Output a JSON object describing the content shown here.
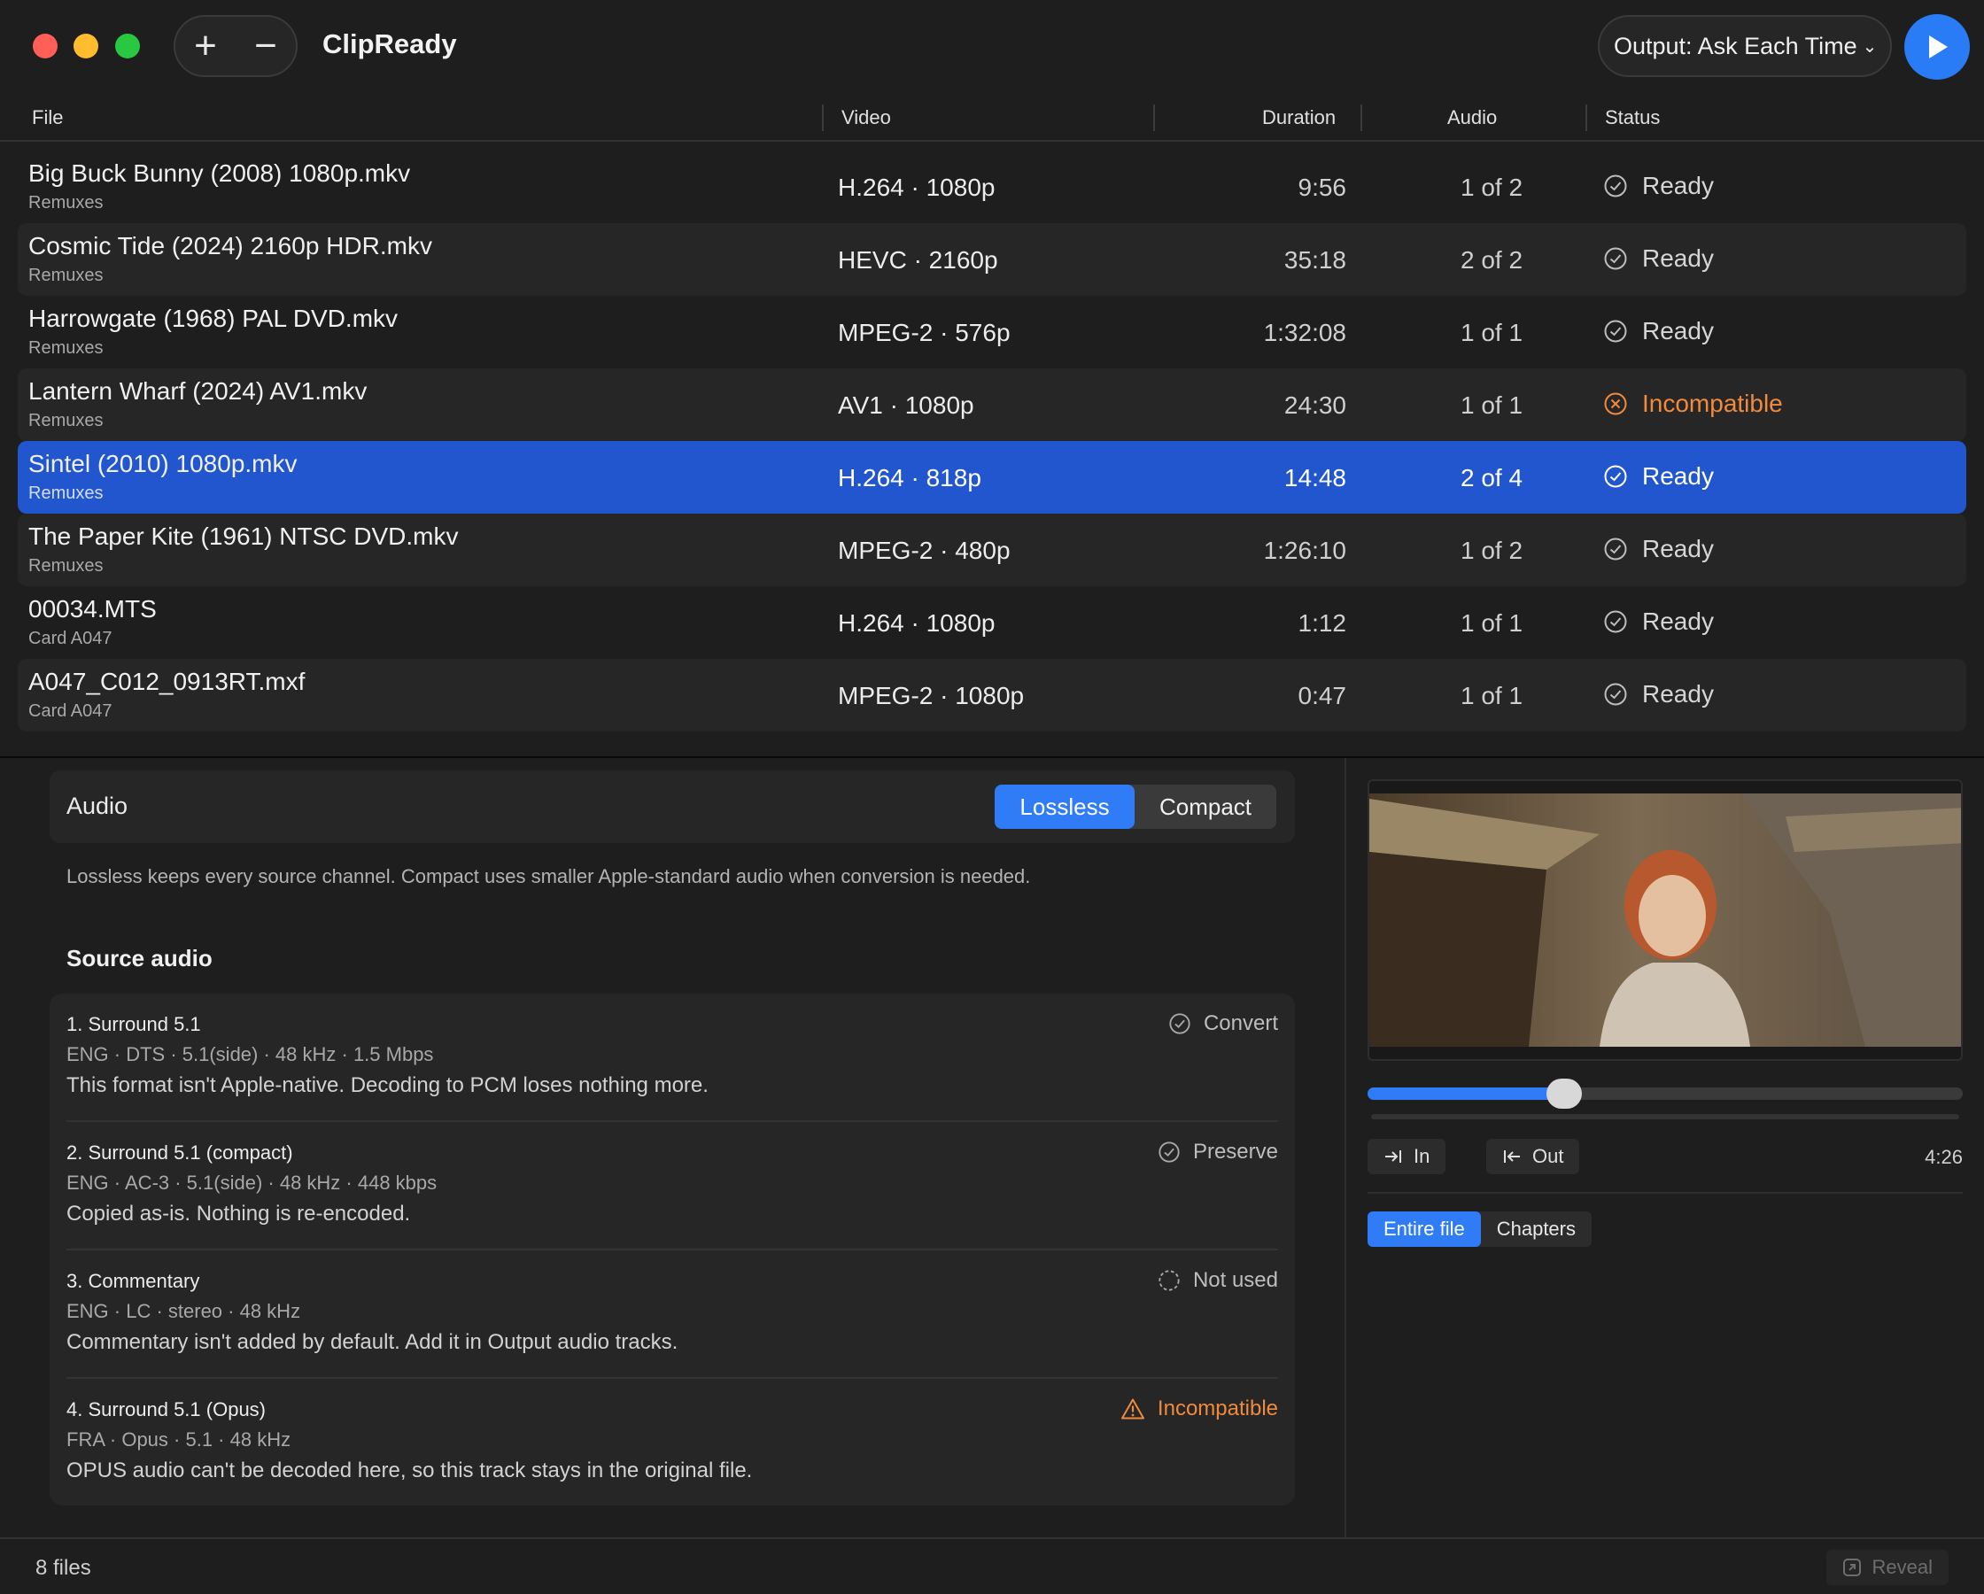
{
  "app": {
    "title": "ClipReady"
  },
  "toolbar": {
    "add_label": "+",
    "remove_label": "−",
    "output_label": "Output: Ask Each Time"
  },
  "table": {
    "headers": {
      "file": "File",
      "video": "Video",
      "duration": "Duration",
      "audio": "Audio",
      "status": "Status"
    },
    "rows": [
      {
        "name": "Big Buck Bunny (2008) 1080p.mkv",
        "folder": "Remuxes",
        "video": "H.264 · 1080p",
        "duration": "9:56",
        "audio": "1 of 2",
        "status": "Ready"
      },
      {
        "name": "Cosmic Tide (2024) 2160p HDR.mkv",
        "folder": "Remuxes",
        "video": "HEVC · 2160p",
        "duration": "35:18",
        "audio": "2 of 2",
        "status": "Ready"
      },
      {
        "name": "Harrowgate (1968) PAL DVD.mkv",
        "folder": "Remuxes",
        "video": "MPEG-2 · 576p",
        "duration": "1:32:08",
        "audio": "1 of 1",
        "status": "Ready"
      },
      {
        "name": "Lantern Wharf (2024) AV1.mkv",
        "folder": "Remuxes",
        "video": "AV1 · 1080p",
        "duration": "24:30",
        "audio": "1 of 1",
        "status": "Incompatible"
      },
      {
        "name": "Sintel (2010) 1080p.mkv",
        "folder": "Remuxes",
        "video": "H.264 · 818p",
        "duration": "14:48",
        "audio": "2 of 4",
        "status": "Ready"
      },
      {
        "name": "The Paper Kite (1961) NTSC DVD.mkv",
        "folder": "Remuxes",
        "video": "MPEG-2 · 480p",
        "duration": "1:26:10",
        "audio": "1 of 2",
        "status": "Ready"
      },
      {
        "name": "00034.MTS",
        "folder": "Card A047",
        "video": "H.264 · 1080p",
        "duration": "1:12",
        "audio": "1 of 1",
        "status": "Ready"
      },
      {
        "name": "A047_C012_0913RT.mxf",
        "folder": "Card A047",
        "video": "MPEG-2 · 1080p",
        "duration": "0:47",
        "audio": "1 of 1",
        "status": "Ready"
      }
    ]
  },
  "detail": {
    "audio_label": "Audio",
    "mode_options": [
      "Lossless",
      "Compact"
    ],
    "mode_selected": "Lossless",
    "hint": "Lossless keeps every source channel. Compact uses smaller Apple-standard audio when conversion is needed.",
    "source_title": "Source audio",
    "tracks": [
      {
        "name": "1. Surround 5.1",
        "meta": "ENG · DTS · 5.1(side) · 48 kHz · 1.5 Mbps",
        "desc": "This format isn't Apple-native. Decoding to PCM loses nothing more.",
        "action": "Convert"
      },
      {
        "name": "2. Surround 5.1 (compact)",
        "meta": "ENG · AC-3 · 5.1(side) · 48 kHz · 448 kbps",
        "desc": "Copied as-is. Nothing is re-encoded.",
        "action": "Preserve"
      },
      {
        "name": "3. Commentary",
        "meta": "ENG · LC · stereo · 48 kHz",
        "desc": "Commentary isn't added by default. Add it in Output audio tracks.",
        "action": "Not used"
      },
      {
        "name": "4. Surround 5.1 (Opus)",
        "meta": "FRA · Opus · 5.1 · 48 kHz",
        "desc": "OPUS audio can't be decoded here, so this track stays in the original file.",
        "action": "Incompatible"
      }
    ]
  },
  "preview": {
    "playhead_fraction": 0.33,
    "in_label": "In",
    "out_label": "Out",
    "timecode": "4:26",
    "scope_options": [
      "Entire file",
      "Chapters"
    ],
    "scope_selected": "Entire file"
  },
  "footer": {
    "count": "8 files",
    "reveal_label": "Reveal"
  },
  "colors": {
    "accent": "#2f7cf6",
    "selection": "#2256cf",
    "warning": "#f08a3c"
  }
}
